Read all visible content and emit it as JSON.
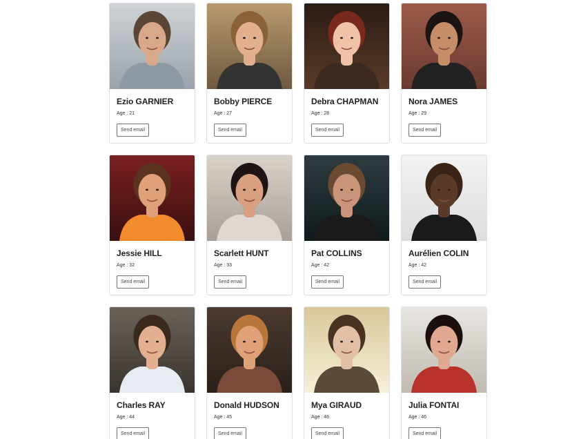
{
  "people": [
    {
      "name": "Ezio GARNIER",
      "age": "Age : 21",
      "button": "Send email",
      "photo": {
        "bg": "#cfd3d6",
        "bg2": "#9aa3ab",
        "skin": "#d9a88a",
        "hair": "#5a4636",
        "shirt": "#8e9aa3"
      }
    },
    {
      "name": "Bobby PIERCE",
      "age": "Age : 27",
      "button": "Send email",
      "photo": {
        "bg": "#b89a6f",
        "bg2": "#6e5a40",
        "skin": "#e2b08e",
        "hair": "#8a6238",
        "shirt": "#333333"
      }
    },
    {
      "name": "Debra CHAPMAN",
      "age": "Age : 28",
      "button": "Send email",
      "photo": {
        "bg": "#2a1b14",
        "bg2": "#5a3a28",
        "skin": "#f0c3a8",
        "hair": "#7a2a1c",
        "shirt": "#3a2a22"
      }
    },
    {
      "name": "Nora JAMES",
      "age": "Age : 29",
      "button": "Send email",
      "photo": {
        "bg": "#9b5a4a",
        "bg2": "#6a3a30",
        "skin": "#c58e68",
        "hair": "#1b1412",
        "shirt": "#222222"
      }
    },
    {
      "name": "Jessie HILL",
      "age": "Age : 32",
      "button": "Send email",
      "photo": {
        "bg": "#7a1f1f",
        "bg2": "#3a1010",
        "skin": "#e0a07a",
        "hair": "#5a3320",
        "shirt": "#f28a2e"
      }
    },
    {
      "name": "Scarlett HUNT",
      "age": "Age : 33",
      "button": "Send email",
      "photo": {
        "bg": "#d8d2c8",
        "bg2": "#a8a098",
        "skin": "#d8a080",
        "hair": "#1e1414",
        "shirt": "#e0d8d0"
      }
    },
    {
      "name": "Pat COLLINS",
      "age": "Age : 42",
      "button": "Send email",
      "photo": {
        "bg": "#2e3c40",
        "bg2": "#101a1c",
        "skin": "#c9957a",
        "hair": "#6a4a30",
        "shirt": "#1a1a1a"
      }
    },
    {
      "name": "Aurélien COLIN",
      "age": "Age : 42",
      "button": "Send email",
      "photo": {
        "bg": "#f2f2f2",
        "bg2": "#dddddd",
        "skin": "#5a3a28",
        "hair": "#3a2418",
        "shirt": "#1a1a1a"
      }
    },
    {
      "name": "Charles RAY",
      "age": "Age : 44",
      "button": "Send email",
      "photo": {
        "bg": "#6a6258",
        "bg2": "#3a3430",
        "skin": "#e2b090",
        "hair": "#3a2a1e",
        "shirt": "#e6ecf2"
      }
    },
    {
      "name": "Donald HUDSON",
      "age": "Age : 45",
      "button": "Send email",
      "photo": {
        "bg": "#4a3a30",
        "bg2": "#2a2018",
        "skin": "#e0a078",
        "hair": "#b8763a",
        "shirt": "#7a4a3a"
      }
    },
    {
      "name": "Mya GIRAUD",
      "age": "Age : 46",
      "button": "Send email",
      "photo": {
        "bg": "#d8c89a",
        "bg2": "#f6f0d8",
        "skin": "#e2c0a6",
        "hair": "#4a3222",
        "shirt": "#5a4a3a"
      }
    },
    {
      "name": "Julia FONTAI",
      "age": "Age : 46",
      "button": "Send email",
      "photo": {
        "bg": "#e8e6e2",
        "bg2": "#c0bab0",
        "skin": "#e0a890",
        "hair": "#1a0f0c",
        "shirt": "#b8322a"
      }
    }
  ]
}
